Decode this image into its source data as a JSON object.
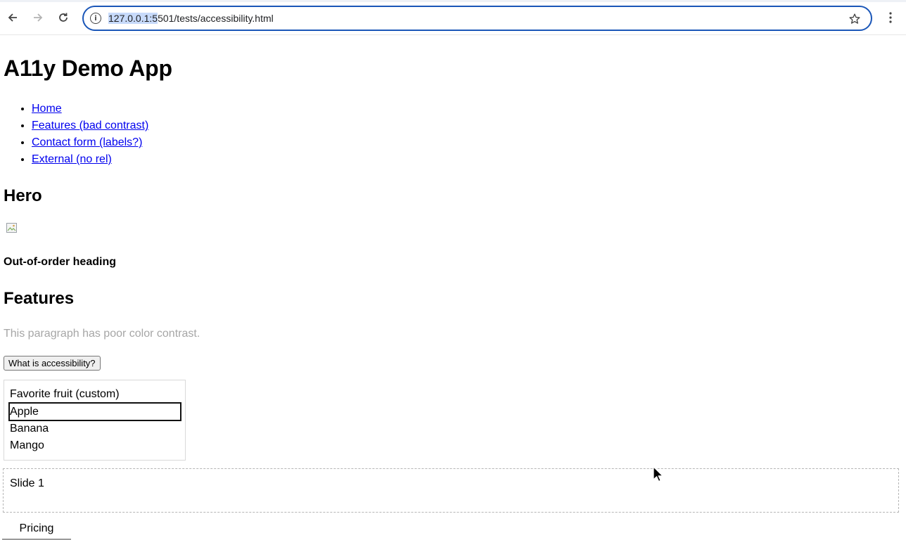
{
  "browser": {
    "url_highlighted": "127.0.0.1:5",
    "url_rest": "501/tests/accessibility.html",
    "icons": {
      "back": "arrow-left-icon",
      "forward": "arrow-right-icon",
      "reload": "reload-icon",
      "site_info": "info-icon",
      "bookmark": "star-icon",
      "menu": "kebab-menu-icon"
    }
  },
  "page": {
    "title": "A11y Demo App",
    "nav_links": [
      {
        "label": "Home"
      },
      {
        "label": "Features (bad contrast)"
      },
      {
        "label": "Contact form (labels?)"
      },
      {
        "label": "External (no rel)"
      }
    ],
    "hero_heading": "Hero",
    "out_of_order_heading": "Out-of-order heading",
    "features_heading": "Features",
    "low_contrast_text": "This paragraph has poor color contrast.",
    "low_contrast_color": "#a6a6a6",
    "link_color": "#0000ee",
    "a11y_button": "What is accessibility?",
    "fruit": {
      "label": "Favorite fruit (custom)",
      "options": [
        "Apple",
        "Banana",
        "Mango"
      ],
      "focused": "Apple"
    },
    "carousel": {
      "slide": "Slide 1"
    },
    "tabs": [
      {
        "label": "Pricing"
      }
    ]
  }
}
